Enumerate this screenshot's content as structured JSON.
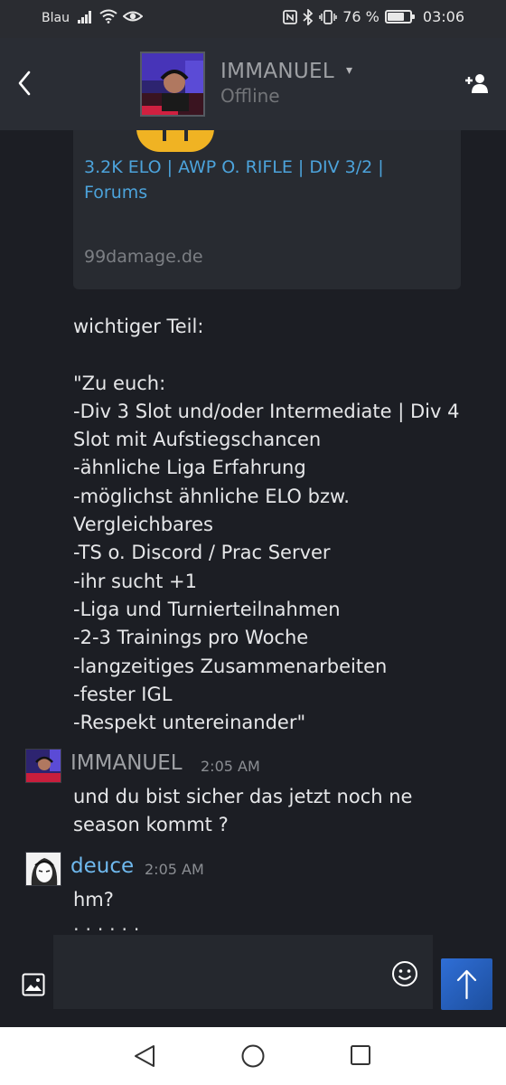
{
  "status_bar": {
    "carrier": "Blau",
    "battery_percent": "76 %",
    "battery_level": 0.76,
    "time": "03:06",
    "icons": [
      "signal-icon",
      "wifi-icon",
      "eye-icon",
      "nfc-icon",
      "bluetooth-icon",
      "vibrate-icon",
      "battery-icon"
    ]
  },
  "header": {
    "contact_name": "IMMANUEL",
    "presence": "Offline",
    "icons": [
      "back-arrow-icon",
      "chevron-down-icon",
      "add-friend-icon"
    ]
  },
  "link_preview": {
    "title": "3.2K ELO | AWP O. RIFLE | DIV 3/2 | Forums",
    "domain": "99damage.de"
  },
  "messages": {
    "m1": "wichtiger Teil:\n\n\"Zu euch:\n-Div 3 Slot und/oder Intermediate | Div 4 Slot mit Aufstiegschancen\n-ähnliche Liga Erfahrung\n-möglichst ähnliche ELO bzw. Vergleichbares\n-TS o. Discord / Prac Server\n-ihr sucht +1\n-Liga und Turnierteilnahmen\n-2-3 Trainings pro Woche\n-langzeitiges Zusammenarbeiten\n-fester IGL\n-Respekt untereinander\"",
    "g2": {
      "author": "IMMANUEL",
      "time": "2:05 AM",
      "text": "und du bist sicher das jetzt noch ne season kommt ?"
    },
    "g3": {
      "author": "deuce",
      "time": "2:05 AM",
      "text": "hm?"
    }
  },
  "colors": {
    "background": "#1c1e24",
    "header": "#2a2d34",
    "link": "#4ca3db",
    "author_offline": "#9ea0a4",
    "author_self": "#6fb9ee",
    "send_button": "#2f6ed6"
  },
  "composer": {
    "placeholder": "",
    "icons": [
      "image-icon",
      "emoji-icon",
      "send-arrow-icon"
    ]
  },
  "nav_bar": {
    "icons": [
      "nav-back-icon",
      "nav-home-icon",
      "nav-recents-icon"
    ]
  }
}
